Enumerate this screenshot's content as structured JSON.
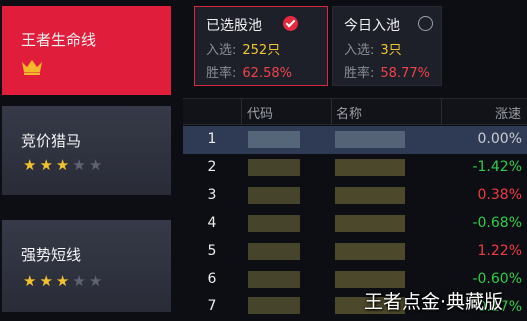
{
  "sidebar": {
    "cards": [
      {
        "title": "王者生命线",
        "icon": "crown-icon",
        "active": true
      },
      {
        "title": "竞价猎马",
        "rating": 3,
        "max_rating": 5,
        "active": false
      },
      {
        "title": "强势短线",
        "rating": 3,
        "max_rating": 5,
        "active": false
      }
    ]
  },
  "pools": {
    "selected_pool": {
      "title": "已选股池",
      "checked": true,
      "count_label": "入选:",
      "count_value": "252只",
      "win_label": "胜率:",
      "win_value": "62.58%"
    },
    "today_pool": {
      "title": "今日入池",
      "checked": false,
      "count_label": "入选:",
      "count_value": "3只",
      "win_label": "胜率:",
      "win_value": "58.77%"
    }
  },
  "table": {
    "headers": {
      "code": "代码",
      "name": "名称",
      "change": "涨速"
    },
    "rows": [
      {
        "rank": "1",
        "change": "0.00%",
        "trend": "flat"
      },
      {
        "rank": "2",
        "change": "-1.42%",
        "trend": "down"
      },
      {
        "rank": "3",
        "change": "0.38%",
        "trend": "up"
      },
      {
        "rank": "4",
        "change": "-0.68%",
        "trend": "down"
      },
      {
        "rank": "5",
        "change": "1.22%",
        "trend": "up"
      },
      {
        "rank": "6",
        "change": "-0.60%",
        "trend": "down"
      },
      {
        "rank": "7",
        "change": "-0.17%",
        "trend": "down"
      }
    ]
  },
  "colors": {
    "active_card": "#e01d3a",
    "up": "#f03a44",
    "down": "#2fcc4a",
    "highlight": "#f2c535"
  },
  "watermark": "王者点金·典藏版"
}
